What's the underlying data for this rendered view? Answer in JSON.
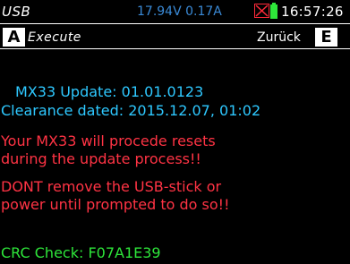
{
  "status": {
    "usb_label": "USB",
    "power": "17.94V 0.17A",
    "time": "16:57:26",
    "colors": {
      "usb": "#ffffff",
      "power": "#3a8ad6",
      "warn": "#ff2a3a",
      "battery": "#2ee63a"
    }
  },
  "softkeys": {
    "left_key": "A",
    "left_label": "Execute",
    "right_label": "Zurück",
    "right_key": "E"
  },
  "content": {
    "update_line": "MX33 Update:  01.01.0123",
    "clearance_line": "Clearance dated: 2015.12.07, 01:02",
    "warning1_line1": "Your MX33 will procede resets",
    "warning1_line2": "during the update process!!",
    "warning2_line1": "DONT remove the USB-stick or",
    "warning2_line2": "power until prompted to do so!!",
    "crc_line": "CRC Check: F07A1E39",
    "colors": {
      "info": "#2ec8ff",
      "warning": "#ff3344",
      "ok": "#2ee63a"
    }
  }
}
